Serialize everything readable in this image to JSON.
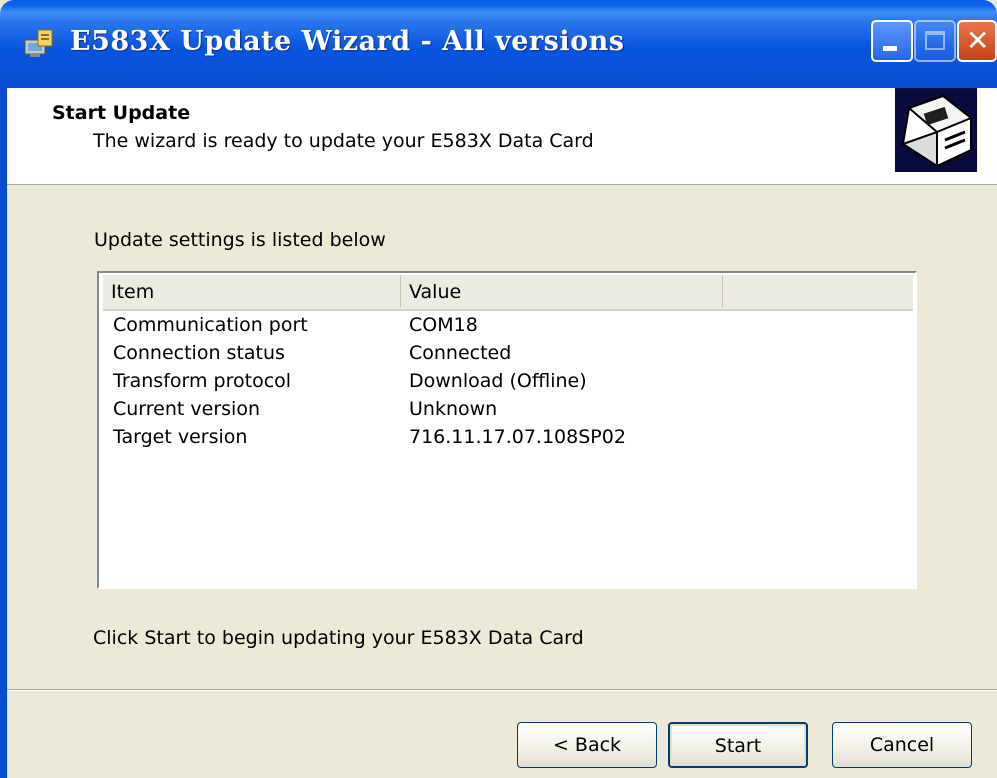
{
  "window": {
    "title": "E583X Update Wizard - All versions",
    "app_icon": "setup-icon"
  },
  "header": {
    "title": "Start Update",
    "subtitle": "The wizard is ready to update your E583X Data Card",
    "image_icon": "computer-card-icon"
  },
  "settings": {
    "label": "Update settings is listed below",
    "columns": [
      "Item",
      "Value",
      ""
    ],
    "rows": [
      {
        "item": "Communication port",
        "value": "COM18"
      },
      {
        "item": "Connection status",
        "value": "Connected"
      },
      {
        "item": "Transform protocol",
        "value": "Download (Offline)"
      },
      {
        "item": "Current version",
        "value": "Unknown"
      },
      {
        "item": "Target version",
        "value": "716.11.17.07.108SP02"
      }
    ]
  },
  "instruction": "Click Start to begin updating your E583X Data Card",
  "buttons": {
    "back": "< Back",
    "start": "Start",
    "cancel": "Cancel"
  },
  "colors": {
    "titlebar": "#0A52D8",
    "dialog_bg": "#ECE9D8",
    "close_button": "#C8401A"
  }
}
